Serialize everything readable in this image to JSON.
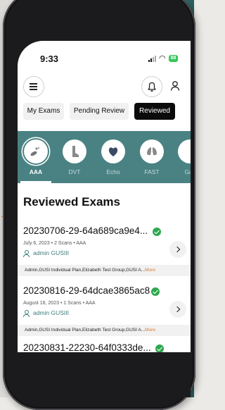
{
  "status": {
    "time": "9:33",
    "battery": "88"
  },
  "tabs": [
    {
      "label": "My Exams"
    },
    {
      "label": "Pending Review"
    },
    {
      "label": "Reviewed",
      "active": true
    }
  ],
  "scan_types": [
    {
      "label": "AAA",
      "icon": "aaa-icon",
      "selected": true
    },
    {
      "label": "DVT",
      "icon": "leg-icon"
    },
    {
      "label": "Echo",
      "icon": "heart-icon"
    },
    {
      "label": "FAST",
      "icon": "lungs-icon"
    },
    {
      "label": "Gall",
      "icon": "gallbladder-icon"
    }
  ],
  "section_title": "Reviewed Exams",
  "exams": [
    {
      "name": "20230706-29-64a689ca9e4...",
      "meta": "July 6, 2023 • 2 Scans • AAA",
      "user": "admin GUSIII",
      "groups": "Admin,GUSI Individual Plan,Elizabeth Test Group,GUSI A...",
      "more": "More"
    },
    {
      "name": "20230816-29-64dcae3865ac8",
      "meta": "August 16, 2023 • 1 Scans • AAA",
      "user": "admin GUSIII",
      "groups": "Admin,GUSI Individual Plan,Elizabeth Test Group,GUSI A...",
      "more": "More"
    },
    {
      "name": "20230831-22230-64f0333de..."
    }
  ],
  "colors": {
    "accent": "#4a8283",
    "check": "#2fa84f",
    "more": "#e07a2c"
  }
}
